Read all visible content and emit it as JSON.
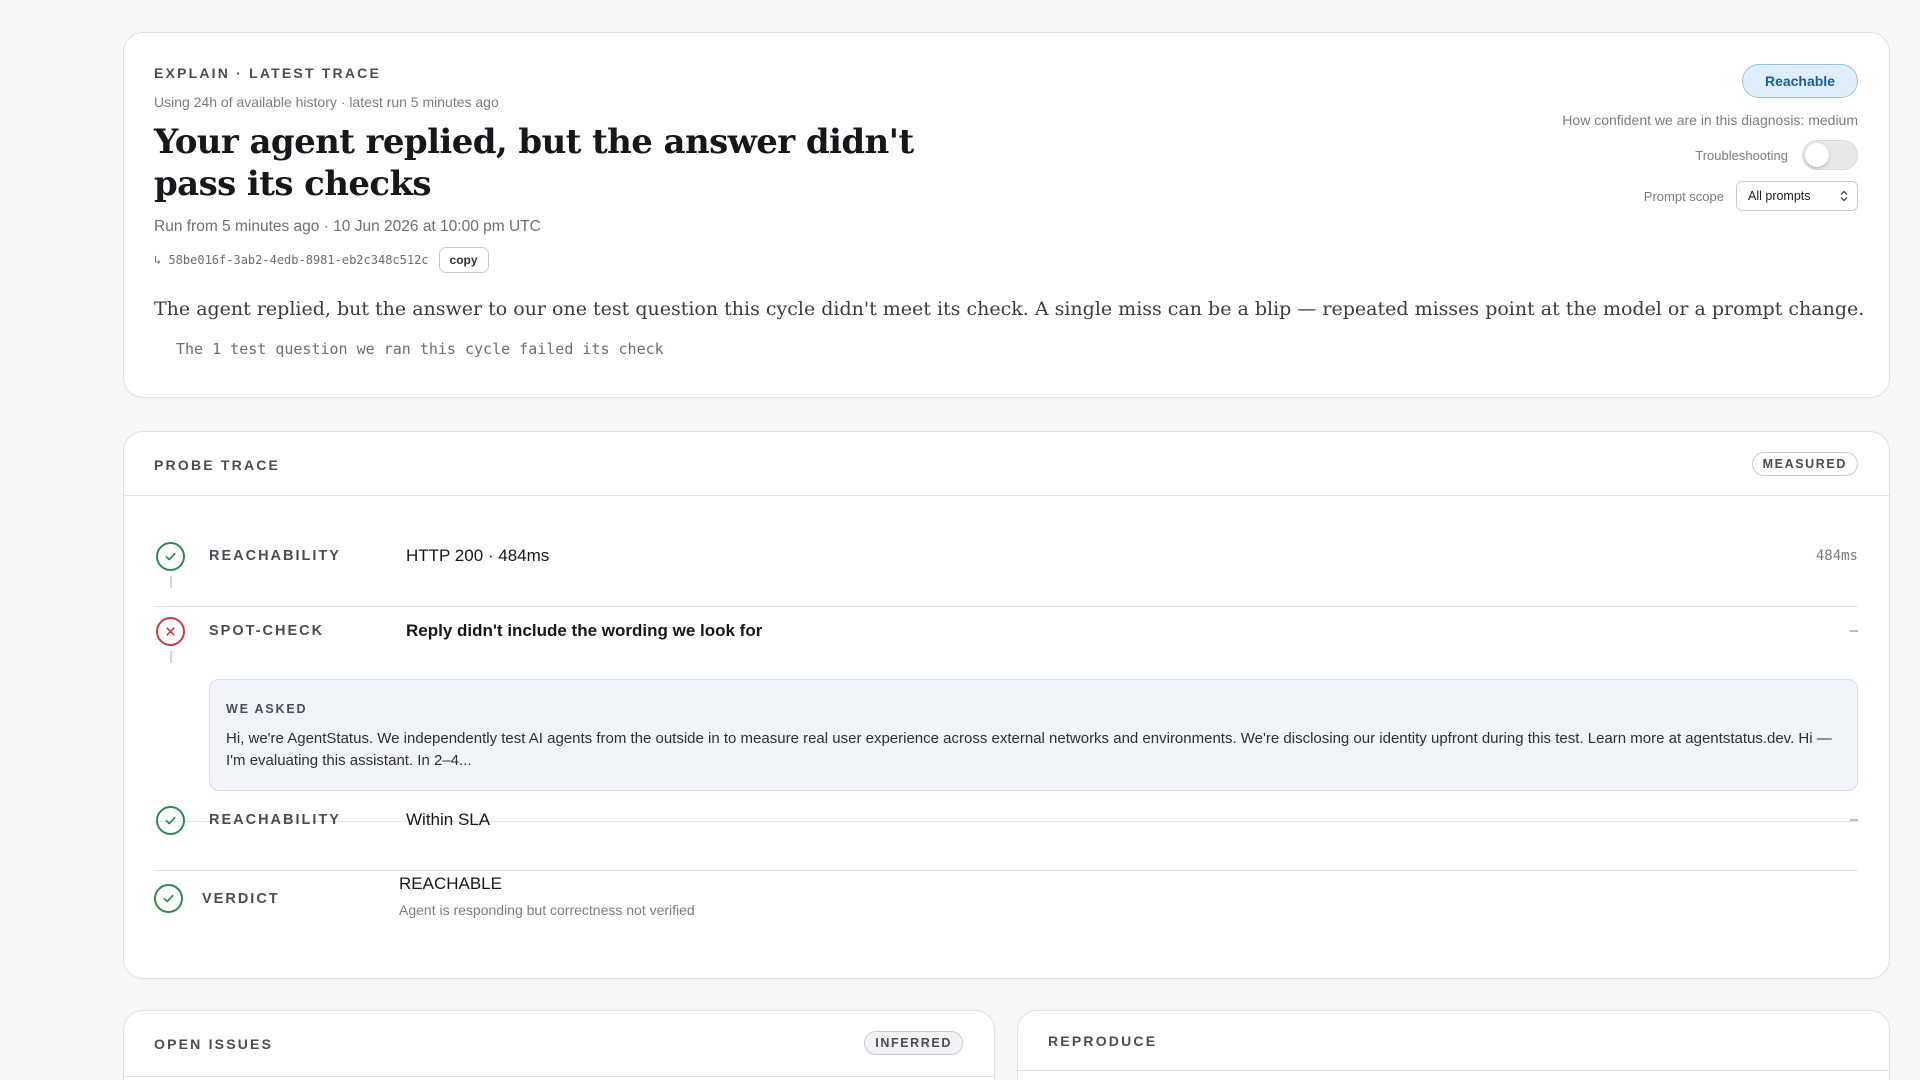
{
  "explain": {
    "eyebrow": "EXPLAIN · LATEST TRACE",
    "history": "Using 24h of available history · latest run 5 minutes ago",
    "headline": "Your agent replied, but the answer didn't pass its checks",
    "run_info": "Run from 5 minutes ago · 10 Jun 2026 at 10:00 pm UTC",
    "trace_id": "↳ 58be016f-3ab2-4edb-8981-eb2c348c512c",
    "copy_label": "copy",
    "body": "The agent replied, but the answer to our one test question this cycle didn't meet its check. A single miss can be a blip — repeated misses point at the model or a prompt change.",
    "detail": "The 1 test question we ran this cycle failed its check",
    "status_pill": "Reachable",
    "confidence": "How confident we are in this diagnosis: medium",
    "troubleshooting_label": "Troubleshooting",
    "troubleshooting_on": false,
    "prompt_scope_label": "Prompt scope",
    "prompt_scope_value": "All prompts"
  },
  "trace": {
    "eyebrow": "PROBE TRACE",
    "tag": "MEASURED",
    "steps": [
      {
        "label": "REACHABILITY",
        "value": "HTTP 200 · 484ms",
        "meta": "484ms",
        "status": "ok"
      },
      {
        "label": "SPOT-CHECK",
        "value": "Reply didn't include the wording we look for",
        "meta": "–",
        "status": "fail",
        "asked_label": "WE ASKED",
        "asked_text": "Hi, we're AgentStatus. We independently test AI agents from the outside in to measure real user experience across external networks and environments. We're disclosing our identity upfront during this test. Learn more at agentstatus.dev. Hi — I'm evaluating this assistant. In 2–4..."
      },
      {
        "label": "REACHABILITY",
        "value": "Within SLA",
        "meta": "–",
        "status": "ok"
      },
      {
        "label": "VERDICT",
        "value": "REACHABLE",
        "sub": "Agent is responding but correctness not verified",
        "status": "ok"
      }
    ]
  },
  "issues": {
    "eyebrow": "OPEN ISSUES",
    "tag": "INFERRED"
  },
  "reproduce": {
    "eyebrow": "REPRODUCE"
  },
  "colors": {
    "ok": "#2e8a57",
    "fail": "#c63d4b",
    "pill_bg": "#dfeefb",
    "pill_text": "#1d5f9e"
  },
  "icons": {
    "ok": "check-circle-icon",
    "fail": "x-circle-icon",
    "select": "chevron-updown-icon"
  }
}
